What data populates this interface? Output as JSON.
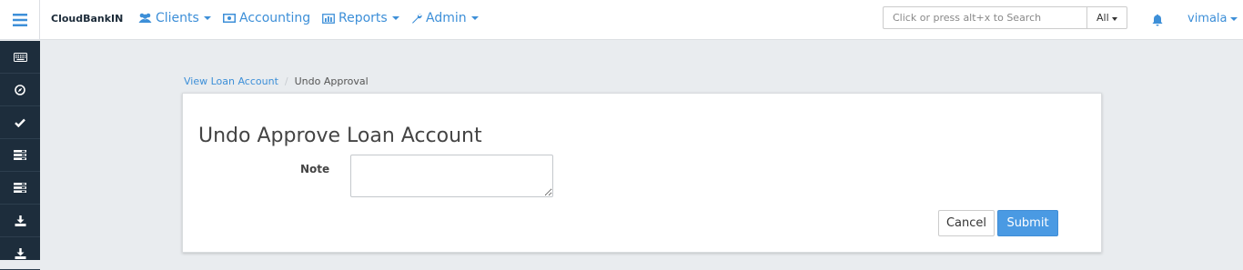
{
  "brand": "CloudBankIN",
  "nav": {
    "clients": "Clients",
    "accounting": "Accounting",
    "reports": "Reports",
    "admin": "Admin"
  },
  "search": {
    "placeholder": "Click or press alt+x to Search",
    "scope": "All"
  },
  "user": {
    "name": "vimala"
  },
  "sidebar": {
    "items": [
      {
        "icon": "keyboard-icon"
      },
      {
        "icon": "compass-icon"
      },
      {
        "icon": "check-icon"
      },
      {
        "icon": "list-icon"
      },
      {
        "icon": "list-icon"
      },
      {
        "icon": "download-icon"
      },
      {
        "icon": "download-icon"
      }
    ]
  },
  "breadcrumb": {
    "link": "View Loan Account",
    "separator": "/",
    "current": "Undo Approval"
  },
  "form": {
    "title": "Undo Approve Loan Account",
    "note_label": "Note",
    "note_value": "",
    "cancel_label": "Cancel",
    "submit_label": "Submit"
  },
  "colors": {
    "accent": "#3d8fd8",
    "sidebar": "#1d2d3c",
    "submit": "#4a9ae3",
    "background": "#e9ecef"
  }
}
